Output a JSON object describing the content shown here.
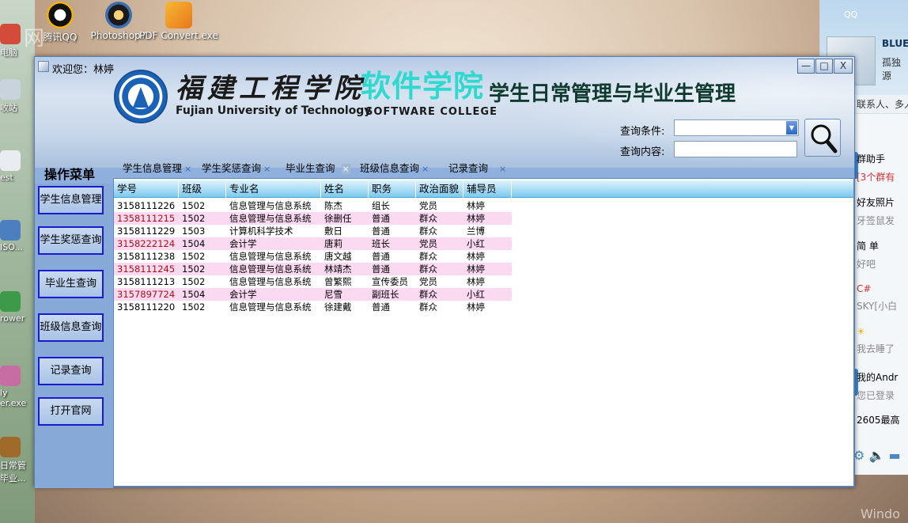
{
  "desktop": {
    "watermark": "网",
    "icons": [
      {
        "label": "腾讯QQ"
      },
      {
        "label": "Photoshop7"
      },
      {
        "label": "PDF Convert.exe"
      }
    ],
    "left_labels": [
      "电脑",
      "收站",
      "est",
      "ISO...",
      "rower",
      "ly er.exe",
      "日常管 毕业..."
    ]
  },
  "qq": {
    "title": "QQ",
    "name": "BLUE",
    "signature": "孤独源",
    "tabs": "联系人、多人",
    "items": [
      {
        "title": "群助手",
        "sub": "[3个群有"
      },
      {
        "title": "好友照片",
        "sub": "牙签鼠发"
      },
      {
        "title": "简 单",
        "sub": "好吧"
      },
      {
        "title": "C#",
        "sub": "SKY[小白"
      },
      {
        "title": "",
        "sub": "我去睡了"
      },
      {
        "title": "我的Andr",
        "sub": "您已登录"
      },
      {
        "title": "2605最高",
        "sub": ""
      }
    ],
    "taskbar_text": "Windo"
  },
  "window": {
    "welcome": "欢迎您：林婷",
    "controls": {
      "minimize": "—",
      "maximize": "□",
      "close": "X"
    },
    "banner": {
      "school_cn": "福建工程学院",
      "school_en": "Fujian University of Technology",
      "college_cn": "软件学院",
      "college_en": "SOFTWARE COLLEGE",
      "system_title": "学生日常管理与毕业生管理"
    },
    "query": {
      "condition_label": "查询条件:",
      "content_label": "查询内容:",
      "condition_value": "",
      "content_value": ""
    },
    "menu": {
      "title": "操作菜单",
      "buttons": [
        "学生信息管理",
        "学生奖惩查询",
        "毕业生查询",
        "班级信息查询",
        "记录查询",
        "打开官网"
      ]
    },
    "tabs": [
      {
        "label": "学生信息管理",
        "close": "×"
      },
      {
        "label": "学生奖惩查询",
        "close": "×"
      },
      {
        "label": "毕业生查询",
        "close": "×"
      },
      {
        "label": "班级信息查询",
        "close": "×"
      },
      {
        "label": "记录查询",
        "close": "×"
      }
    ],
    "table": {
      "columns": [
        "学号",
        "班级",
        "专业名",
        "姓名",
        "职务",
        "政治面貌",
        "辅导员"
      ],
      "rows": [
        [
          "3158111226",
          "1502",
          "信息管理与信息系统",
          "陈杰",
          "组长",
          "党员",
          "林婷"
        ],
        [
          "1358111215",
          "1502",
          "信息管理与信息系统",
          "徐删任",
          "普通",
          "群众",
          "林婷"
        ],
        [
          "3158111229",
          "1503",
          "计算机科学技术",
          "敷日",
          "普通",
          "群众",
          "兰博"
        ],
        [
          "3158222124",
          "1504",
          "会计学",
          "唐莉",
          "班长",
          "党员",
          "小红"
        ],
        [
          "3158111238",
          "1502",
          "信息管理与信息系统",
          "唐文越",
          "普通",
          "群众",
          "林婷"
        ],
        [
          "3158111245",
          "1502",
          "信息管理与信息系统",
          "林靖杰",
          "普通",
          "群众",
          "林婷"
        ],
        [
          "3158111213",
          "1502",
          "信息管理与信息系统",
          "曾繁熙",
          "宣传委员",
          "党员",
          "林婷"
        ],
        [
          "3157897724",
          "1504",
          "会计学",
          "尼雪",
          "副班长",
          "群众",
          "小红"
        ],
        [
          "3158111220",
          "1502",
          "信息管理与信息系统",
          "徐建戴",
          "普通",
          "群众",
          "林婷"
        ]
      ]
    }
  }
}
